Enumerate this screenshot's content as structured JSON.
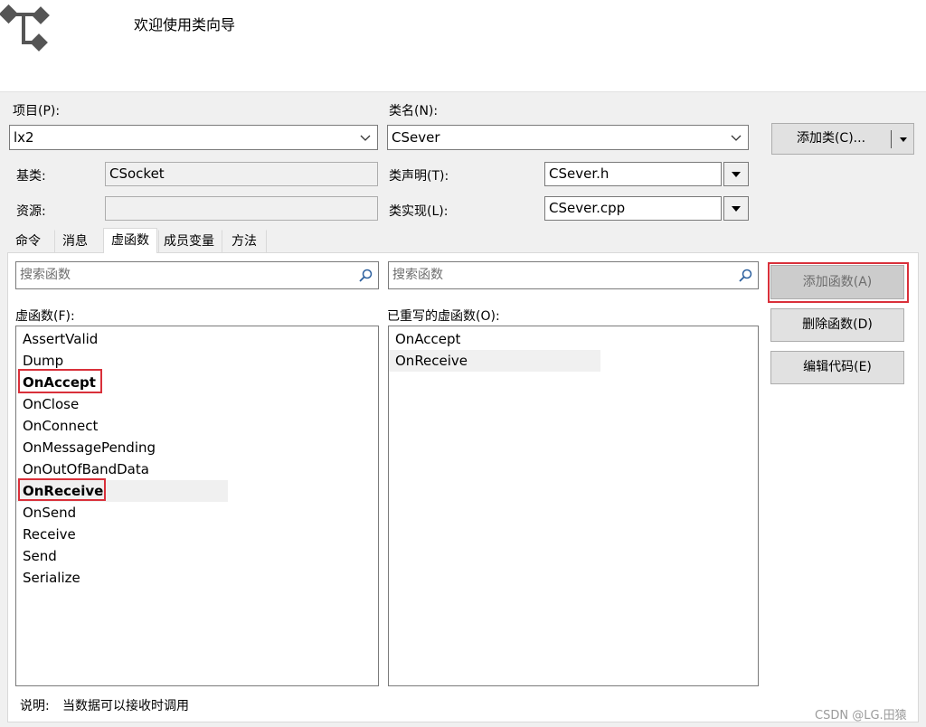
{
  "header": {
    "title": "欢迎使用类向导",
    "icon": "class-wizard-icon"
  },
  "project": {
    "label": "项目(P):",
    "value": "lx2"
  },
  "class_name": {
    "label": "类名(N):",
    "value": "CSever"
  },
  "add_class_button": "添加类(C)...",
  "base_class": {
    "label": "基类:",
    "value": "CSocket"
  },
  "resource": {
    "label": "资源:",
    "value": ""
  },
  "class_declaration": {
    "label": "类声明(T):",
    "value": "CSever.h"
  },
  "class_implementation": {
    "label": "类实现(L):",
    "value": "CSever.cpp"
  },
  "tabs": [
    {
      "label": "命令",
      "active": false
    },
    {
      "label": "消息",
      "active": false
    },
    {
      "label": "虚函数",
      "active": true
    },
    {
      "label": "成员变量",
      "active": false
    },
    {
      "label": "方法",
      "active": false
    }
  ],
  "left_search": {
    "placeholder": "搜索函数"
  },
  "right_search": {
    "placeholder": "搜索函数"
  },
  "virtual_functions": {
    "label": "虚函数(F):",
    "items": [
      "AssertValid",
      "Dump",
      "OnAccept",
      "OnClose",
      "OnConnect",
      "OnMessagePending",
      "OnOutOfBandData",
      "OnReceive",
      "OnSend",
      "Receive",
      "Send",
      "Serialize"
    ]
  },
  "overridden_functions": {
    "label": "已重写的虚函数(O):",
    "items": [
      "OnAccept",
      "OnReceive"
    ]
  },
  "buttons": {
    "add_function": "添加函数(A)",
    "delete_function": "删除函数(D)",
    "edit_code": "编辑代码(E)"
  },
  "description": {
    "label": "说明:",
    "text": "当数据可以接收时调用"
  },
  "watermark": "CSDN @LG.田猿",
  "colors": {
    "highlight_border": "#d9303a",
    "row_highlight": "#f0f0f0"
  }
}
